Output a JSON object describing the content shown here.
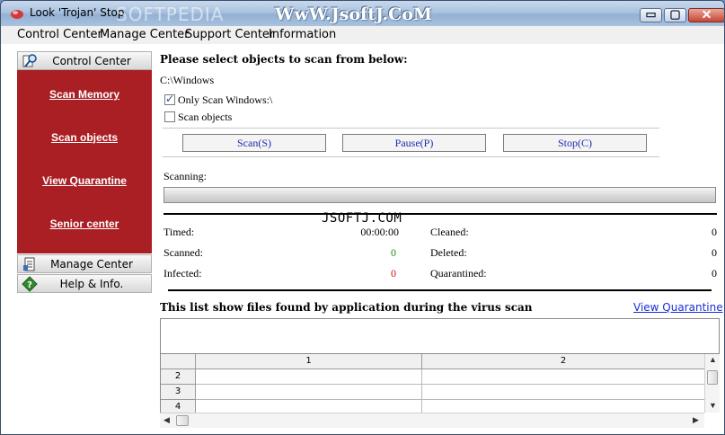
{
  "window": {
    "title": "Look 'Trojan' Stop",
    "watermark_faint": "SOFTPEDIA",
    "watermark_top": "WwW.JsoftJ.CoM",
    "buttons": {
      "minimize": "▭",
      "maximize": "▢",
      "close": "✕"
    }
  },
  "menu": [
    "Control Center",
    "Manage Center",
    "Support Center",
    "Information"
  ],
  "sidebar": {
    "control_center": "Control Center",
    "links": [
      "Scan Memory",
      "Scan objects",
      "View Quarantine",
      "Senior center"
    ],
    "manage_center": "Manage Center",
    "help_info": "Help & Info."
  },
  "scan": {
    "heading": "Please select objects to scan from below:",
    "path": "C:\\Windows",
    "only_windows_label": "Only Scan Windows:\\",
    "only_windows_checked": true,
    "scan_objects_label": "Scan objects",
    "scan_objects_checked": false,
    "buttons": {
      "scan": "Scan(S)",
      "pause": "Pause(P)",
      "stop": "Stop(C)"
    },
    "scanning_label": "Scanning:",
    "progress": 0
  },
  "watermark_mid": "JSOFTJ.COM",
  "stats": {
    "timed_label": "Timed:",
    "timed_value": "00:00:00",
    "scanned_label": "Scanned:",
    "scanned_value": "0",
    "infected_label": "Infected:",
    "infected_value": "0",
    "cleaned_label": "Cleaned:",
    "cleaned_value": "0",
    "deleted_label": "Deleted:",
    "deleted_value": "0",
    "quarantined_label": "Quarantined:",
    "quarantined_value": "0"
  },
  "colors": {
    "scanned_value": "#1a8a1a",
    "infected_value": "#d01010",
    "sidebar_red": "#a91f23"
  },
  "results": {
    "heading": "This list show files found by application during the virus scan",
    "view_quarantine": "View Quarantine",
    "columns": [
      "1",
      "2"
    ],
    "rows": [
      "2",
      "3",
      "4"
    ]
  }
}
